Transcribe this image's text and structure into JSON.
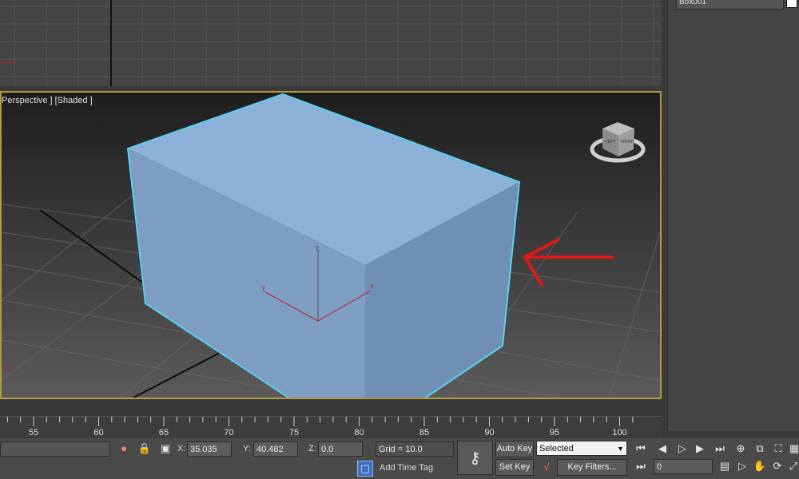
{
  "viewport_label": "Perspective ] [Shaded ]",
  "object_name": "Box001",
  "axes": {
    "x": "x",
    "y": "y",
    "z": "z"
  },
  "viewcube": {
    "left": "LEFT",
    "front": "FRONT"
  },
  "timeline": {
    "ticks": [
      "55",
      "60",
      "65",
      "70",
      "75",
      "80",
      "85",
      "90",
      "95",
      "100"
    ]
  },
  "coords": {
    "x_label": "X:",
    "x_value": "35.035",
    "y_label": "Y:",
    "y_value": "40.482",
    "z_label": "Z:",
    "z_value": "0.0"
  },
  "grid_text": "Grid = 10.0",
  "add_time_tag": "Add Time Tag",
  "auto_key": "Auto Key",
  "set_key": "Set Key",
  "selected_option": "Selected",
  "key_filters": "Key Filters...",
  "frame_value": "0",
  "colors": {
    "selection_outline": "#5ad0f0",
    "box_fill": "#8aaed6",
    "viewport_border": "#b39a3c",
    "arrow": "#e01818"
  }
}
